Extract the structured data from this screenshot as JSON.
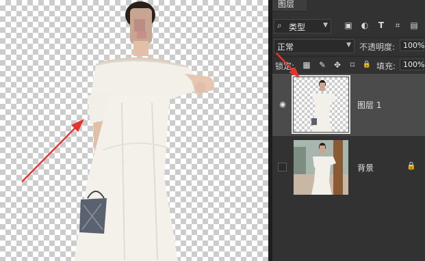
{
  "panel": {
    "tab_label": "图层",
    "filter": {
      "label": "类型",
      "icon": "search-icon"
    },
    "filter_icons": [
      "image-filter-icon",
      "adjustment-filter-icon",
      "type-filter-icon",
      "shape-filter-icon",
      "smart-object-filter-icon"
    ],
    "filter_glyphs": [
      "▣",
      "◐",
      "T",
      "⌗",
      "▤"
    ],
    "blend_mode": "正常",
    "opacity_label": "不透明度:",
    "opacity_value": "100%",
    "lock_label": "锁定:",
    "lock_icons": [
      "lock-transparent-icon",
      "lock-paint-icon",
      "lock-position-icon",
      "lock-artboard-icon",
      "lock-all-icon"
    ],
    "lock_glyphs": [
      "▦",
      "✎",
      "✥",
      "⌑",
      "🔒"
    ],
    "fill_label": "填充:",
    "fill_value": "100%"
  },
  "layers": [
    {
      "name": "图层 1",
      "visible": true,
      "selected": true,
      "locked": false
    },
    {
      "name": "背景",
      "visible": false,
      "selected": false,
      "locked": true
    }
  ],
  "colors": {
    "arrow": "#e8322d",
    "panel_bg": "#323232",
    "selected_layer": "#4b4b4b"
  }
}
